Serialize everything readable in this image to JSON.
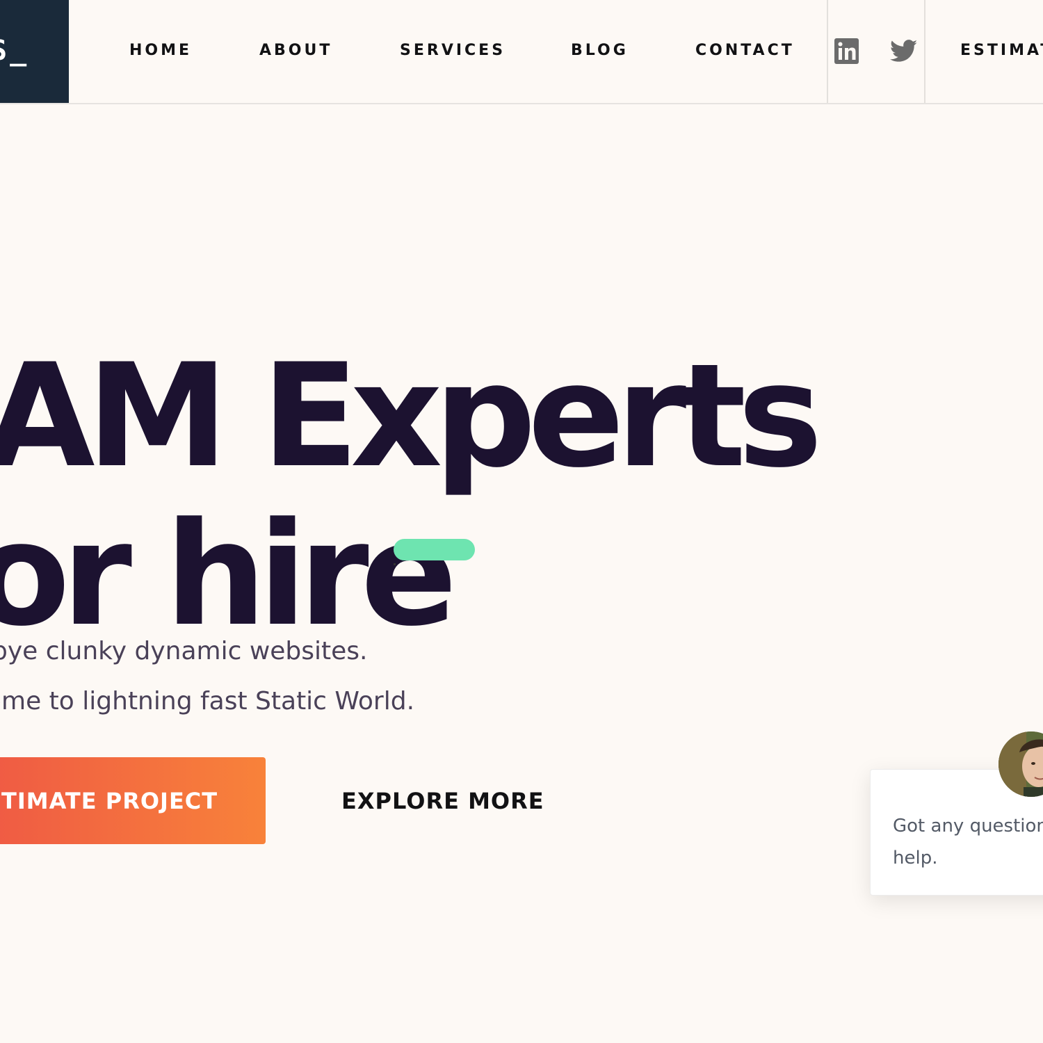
{
  "logo": {
    "text": "S_"
  },
  "nav": {
    "items": [
      {
        "label": "HOME"
      },
      {
        "label": "ABOUT"
      },
      {
        "label": "SERVICES"
      },
      {
        "label": "BLOG"
      },
      {
        "label": "CONTACT"
      }
    ],
    "social": [
      {
        "icon": "linkedin-icon"
      },
      {
        "icon": "twitter-icon"
      }
    ],
    "cta_label": "ESTIMAT"
  },
  "hero": {
    "line1": "AM Experts",
    "line2": "or hire"
  },
  "subtitle": {
    "line1": "bye clunky dynamic websites.",
    "line2": "ome to lightning fast Static World."
  },
  "buttons": {
    "estimate_label": "STIMATE PROJECT",
    "explore_label": "EXPLORE MORE"
  },
  "chat": {
    "message": "Got any questions? help."
  },
  "colors": {
    "logo_bg": "#1a2a3a",
    "hero_text": "#1c1230",
    "accent_green": "#6ee4b0",
    "cta_gradient_start": "#ef5a44",
    "cta_gradient_end": "#f8823a",
    "background": "#fdf9f5"
  }
}
